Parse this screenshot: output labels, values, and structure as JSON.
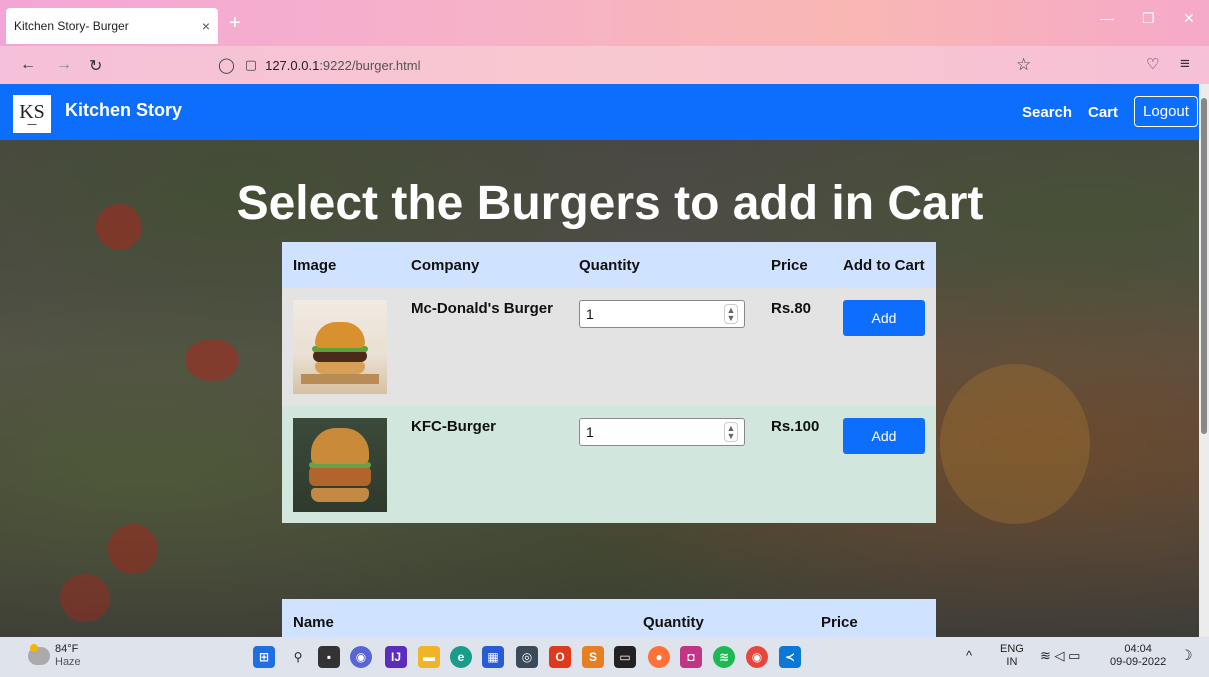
{
  "browser": {
    "tab_title": "Kitchen Story- Burger",
    "tab_close": "×",
    "new_tab": "+",
    "url_host": "127.0.0.1",
    "url_path": ":9222/burger.html"
  },
  "navbar": {
    "logo_text": "KS",
    "brand": "Kitchen Story",
    "search": "Search",
    "cart": "Cart",
    "cart_count": "",
    "logout": "Logout"
  },
  "page": {
    "heading": "Select the Burgers to add in Cart"
  },
  "product_table": {
    "headers": [
      "Image",
      "Company",
      "Quantity",
      "Price",
      "Add to Cart"
    ],
    "rows": [
      {
        "company": "Mc-Donald's Burger",
        "quantity": "1",
        "price": "Rs.80",
        "action": "Add"
      },
      {
        "company": "KFC-Burger",
        "quantity": "1",
        "price": "Rs.100",
        "action": "Add"
      }
    ]
  },
  "cart_table": {
    "headers": [
      "Name",
      "Quantity",
      "Price"
    ]
  },
  "taskbar": {
    "temperature": "84°F",
    "condition": "Haze",
    "lang": "ENG",
    "region": "IN",
    "time": "04:04",
    "date": "09-09-2022"
  },
  "colors": {
    "primary": "#0d6efd",
    "table_header": "#cfe2ff",
    "row_grey": "#e3e3e3",
    "row_green": "#d1e7dd"
  }
}
